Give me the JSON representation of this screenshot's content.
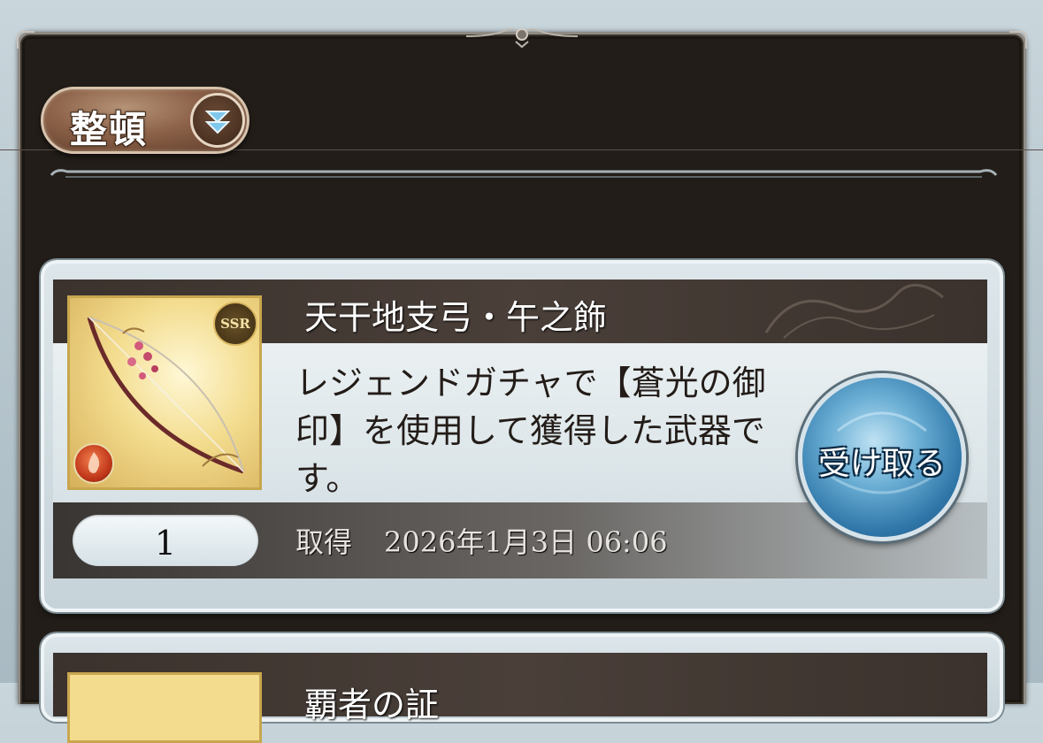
{
  "toolbar": {
    "sort_label": "整頓"
  },
  "items": [
    {
      "name": "天干地支弓・午之飾",
      "description": "レジェンドガチャで【蒼光の御印】を使用して獲得した武器です。",
      "quantity": "1",
      "acquired_label": "取得",
      "acquired_date": "2026年1月3日 06:06",
      "rarity_badge": "SSR",
      "element": "fire",
      "receive_label": "受け取る"
    },
    {
      "name": "覇者の証"
    }
  ],
  "colors": {
    "frame": "#221d18",
    "card": "#dde6ea",
    "receive_button": "#2f76a8",
    "sort_button": "#8b6148"
  },
  "icons": [
    "chevron-double-down-icon",
    "ssr-badge-icon",
    "fire-element-icon"
  ]
}
